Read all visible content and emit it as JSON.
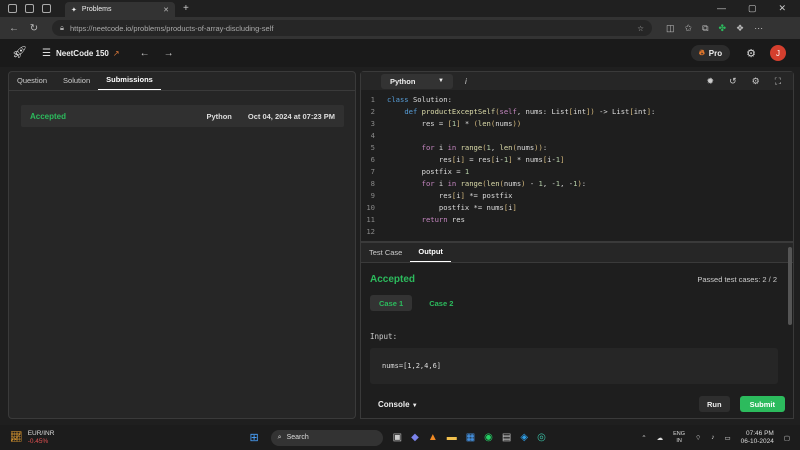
{
  "browser": {
    "tab_title": "Problems",
    "url": "https://neetcode.io/problems/products-of-array-discluding-self"
  },
  "app": {
    "brand": "NeetCode 150",
    "pro_label": "Pro",
    "avatar_initial": "J"
  },
  "left_panel": {
    "tabs": [
      "Question",
      "Solution",
      "Submissions"
    ],
    "submission": {
      "status": "Accepted",
      "language": "Python",
      "date": "Oct 04, 2024 at 07:23 PM"
    }
  },
  "editor": {
    "language": "Python",
    "line_numbers": [
      "1",
      "2",
      "3",
      "4",
      "5",
      "6",
      "7",
      "8",
      "9",
      "10",
      "11",
      "12"
    ]
  },
  "console": {
    "tabs": [
      "Test Case",
      "Output"
    ],
    "result": "Accepted",
    "passed": "Passed test cases: 2 / 2",
    "cases": [
      "Case 1",
      "Case 2"
    ],
    "input_label": "Input:",
    "input_value": "nums=[1,2,4,6]",
    "console_label": "Console",
    "run_label": "Run",
    "submit_label": "Submit"
  },
  "taskbar": {
    "weather_title": "EUR/INR",
    "weather_sub": "-0.45%",
    "search_placeholder": "Search",
    "lang_top": "ENG",
    "lang_bottom": "IN",
    "time": "07:46 PM",
    "date": "06-10-2024"
  },
  "colors": {
    "accent_green": "#2cbb5d",
    "brand_orange": "#e07a3a",
    "avatar_red": "#d43f2e"
  }
}
